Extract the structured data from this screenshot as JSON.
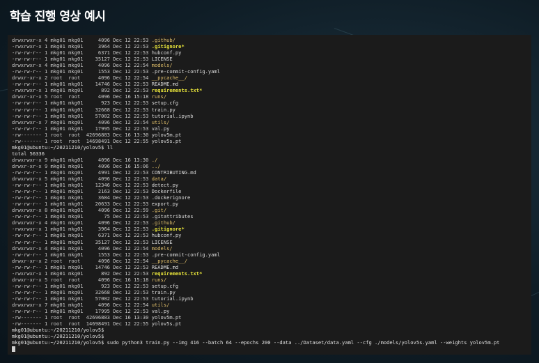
{
  "title": "학습 진행 영상 예시",
  "terminal": {
    "lines": [
      {
        "perm": "drwxrwxr-x 4 mkg01 mkg01",
        "meta": "     4096 Dec 12 22:53 ",
        "name": ".github/",
        "kind": "dir"
      },
      {
        "perm": "-rwxrwxr-x 1 mkg01 mkg01",
        "meta": "     3964 Dec 12 22:53 ",
        "name": ".gitignore*",
        "kind": "exec"
      },
      {
        "perm": "-rw-rw-r-- 1 mkg01 mkg01",
        "meta": "     6371 Dec 12 22:53 ",
        "name": "hubconf.py",
        "kind": "file"
      },
      {
        "perm": "-rw-rw-r-- 1 mkg01 mkg01",
        "meta": "    35127 Dec 12 22:53 ",
        "name": "LICENSE",
        "kind": "file"
      },
      {
        "perm": "drwxrwxr-x 4 mkg01 mkg01",
        "meta": "     4096 Dec 12 22:54 ",
        "name": "models/",
        "kind": "dir"
      },
      {
        "perm": "-rw-rw-r-- 1 mkg01 mkg01",
        "meta": "     1553 Dec 12 22:53 ",
        "name": ".pre-commit-config.yaml",
        "kind": "file"
      },
      {
        "perm": "drwxr-xr-x 2 root  root ",
        "meta": "     4096 Dec 12 22:54 ",
        "name": "__pycache__/",
        "kind": "dir"
      },
      {
        "perm": "-rw-rw-r-- 1 mkg01 mkg01",
        "meta": "    14746 Dec 12 22:53 ",
        "name": "README.md",
        "kind": "file"
      },
      {
        "perm": "-rwxrwxr-x 1 mkg01 mkg01",
        "meta": "      892 Dec 12 22:53 ",
        "name": "requirements.txt*",
        "kind": "exec"
      },
      {
        "perm": "drwxr-xr-x 5 root  root ",
        "meta": "     4096 Dec 16 15:18 ",
        "name": "runs/",
        "kind": "dir"
      },
      {
        "perm": "-rw-rw-r-- 1 mkg01 mkg01",
        "meta": "      923 Dec 12 22:53 ",
        "name": "setup.cfg",
        "kind": "file"
      },
      {
        "perm": "-rw-rw-r-- 1 mkg01 mkg01",
        "meta": "    32668 Dec 12 22:53 ",
        "name": "train.py",
        "kind": "file"
      },
      {
        "perm": "-rw-rw-r-- 1 mkg01 mkg01",
        "meta": "    57002 Dec 12 22:53 ",
        "name": "tutorial.ipynb",
        "kind": "file"
      },
      {
        "perm": "drwxrwxr-x 7 mkg01 mkg01",
        "meta": "     4096 Dec 12 22:54 ",
        "name": "utils/",
        "kind": "dir"
      },
      {
        "perm": "-rw-rw-r-- 1 mkg01 mkg01",
        "meta": "    17995 Dec 12 22:53 ",
        "name": "val.py",
        "kind": "file"
      },
      {
        "perm": "-rw------- 1 root  root ",
        "meta": " 42696883 Dec 16 13:30 ",
        "name": "yolov5m.pt",
        "kind": "file"
      },
      {
        "perm": "-rw------- 1 root  root ",
        "meta": " 14698491 Dec 12 22:55 ",
        "name": "yolov5s.pt",
        "kind": "file"
      },
      {
        "text": "mkg01@ubuntu:~/20211210/yolov5$ ll",
        "kind": "prompt"
      },
      {
        "text": "total 56336",
        "kind": "prompt"
      },
      {
        "perm": "drwxrwxr-x 9 mkg01 mkg01",
        "meta": "     4096 Dec 16 13:30 ",
        "name": "./",
        "kind": "dir"
      },
      {
        "perm": "drwxr-xr-x 9 mkg01 mkg01",
        "meta": "     4096 Dec 16 15:06 ",
        "name": "../",
        "kind": "dir"
      },
      {
        "perm": "-rw-rw-r-- 1 mkg01 mkg01",
        "meta": "     4991 Dec 12 22:53 ",
        "name": "CONTRIBUTING.md",
        "kind": "file"
      },
      {
        "perm": "drwxrwxr-x 5 mkg01 mkg01",
        "meta": "     4096 Dec 12 22:53 ",
        "name": "data/",
        "kind": "dir"
      },
      {
        "perm": "-rw-rw-r-- 1 mkg01 mkg01",
        "meta": "    12346 Dec 12 22:53 ",
        "name": "detect.py",
        "kind": "file"
      },
      {
        "perm": "-rw-rw-r-- 1 mkg01 mkg01",
        "meta": "     2163 Dec 12 22:53 ",
        "name": "Dockerfile",
        "kind": "file"
      },
      {
        "perm": "-rw-rw-r-- 1 mkg01 mkg01",
        "meta": "     3684 Dec 12 22:53 ",
        "name": ".dockerignore",
        "kind": "file"
      },
      {
        "perm": "-rw-rw-r-- 1 mkg01 mkg01",
        "meta": "    20633 Dec 12 22:53 ",
        "name": "export.py",
        "kind": "file"
      },
      {
        "perm": "drwxrwxr-x 8 mkg01 mkg01",
        "meta": "     4096 Dec 12 22:59 ",
        "name": ".git/",
        "kind": "dir"
      },
      {
        "perm": "-rw-rw-r-- 1 mkg01 mkg01",
        "meta": "       75 Dec 12 22:53 ",
        "name": ".gitattributes",
        "kind": "file"
      },
      {
        "perm": "drwxrwxr-x 4 mkg01 mkg01",
        "meta": "     4096 Dec 12 22:53 ",
        "name": ".github/",
        "kind": "dir"
      },
      {
        "perm": "-rwxrwxr-x 1 mkg01 mkg01",
        "meta": "     3964 Dec 12 22:53 ",
        "name": ".gitignore*",
        "kind": "exec"
      },
      {
        "perm": "-rw-rw-r-- 1 mkg01 mkg01",
        "meta": "     6371 Dec 12 22:53 ",
        "name": "hubconf.py",
        "kind": "file"
      },
      {
        "perm": "-rw-rw-r-- 1 mkg01 mkg01",
        "meta": "    35127 Dec 12 22:53 ",
        "name": "LICENSE",
        "kind": "file"
      },
      {
        "perm": "drwxrwxr-x 4 mkg01 mkg01",
        "meta": "     4096 Dec 12 22:54 ",
        "name": "models/",
        "kind": "dir"
      },
      {
        "perm": "-rw-rw-r-- 1 mkg01 mkg01",
        "meta": "     1553 Dec 12 22:53 ",
        "name": ".pre-commit-config.yaml",
        "kind": "file"
      },
      {
        "perm": "drwxr-xr-x 2 root  root ",
        "meta": "     4096 Dec 12 22:54 ",
        "name": "__pycache__/",
        "kind": "dir"
      },
      {
        "perm": "-rw-rw-r-- 1 mkg01 mkg01",
        "meta": "    14746 Dec 12 22:53 ",
        "name": "README.md",
        "kind": "file"
      },
      {
        "perm": "-rwxrwxr-x 1 mkg01 mkg01",
        "meta": "      892 Dec 12 22:53 ",
        "name": "requirements.txt*",
        "kind": "exec"
      },
      {
        "perm": "drwxr-xr-x 5 root  root ",
        "meta": "     4096 Dec 16 15:18 ",
        "name": "runs/",
        "kind": "dir"
      },
      {
        "perm": "-rw-rw-r-- 1 mkg01 mkg01",
        "meta": "      923 Dec 12 22:53 ",
        "name": "setup.cfg",
        "kind": "file"
      },
      {
        "perm": "-rw-rw-r-- 1 mkg01 mkg01",
        "meta": "    32668 Dec 12 22:53 ",
        "name": "train.py",
        "kind": "file"
      },
      {
        "perm": "-rw-rw-r-- 1 mkg01 mkg01",
        "meta": "    57002 Dec 12 22:53 ",
        "name": "tutorial.ipynb",
        "kind": "file"
      },
      {
        "perm": "drwxrwxr-x 7 mkg01 mkg01",
        "meta": "     4096 Dec 12 22:54 ",
        "name": "utils/",
        "kind": "dir"
      },
      {
        "perm": "-rw-rw-r-- 1 mkg01 mkg01",
        "meta": "    17995 Dec 12 22:53 ",
        "name": "val.py",
        "kind": "file"
      },
      {
        "perm": "-rw------- 1 root  root ",
        "meta": " 42696883 Dec 16 13:30 ",
        "name": "yolov5m.pt",
        "kind": "file"
      },
      {
        "perm": "-rw------- 1 root  root ",
        "meta": " 14698491 Dec 12 22:55 ",
        "name": "yolov5s.pt",
        "kind": "file"
      },
      {
        "text": "mkg01@ubuntu:~/20211210/yolov5$",
        "kind": "prompt"
      },
      {
        "text": "mkg01@ubuntu:~/20211210/yolov5$",
        "kind": "prompt"
      },
      {
        "text": "mkg01@ubuntu:~/20211210/yolov5$ sudo python3 train.py --img 416 --batch 64 --epochs 200 --data ../Dataset/data.yaml --cfg ./models/yolov5s.yaml --weights yolov5m.pt",
        "kind": "prompt"
      }
    ]
  }
}
